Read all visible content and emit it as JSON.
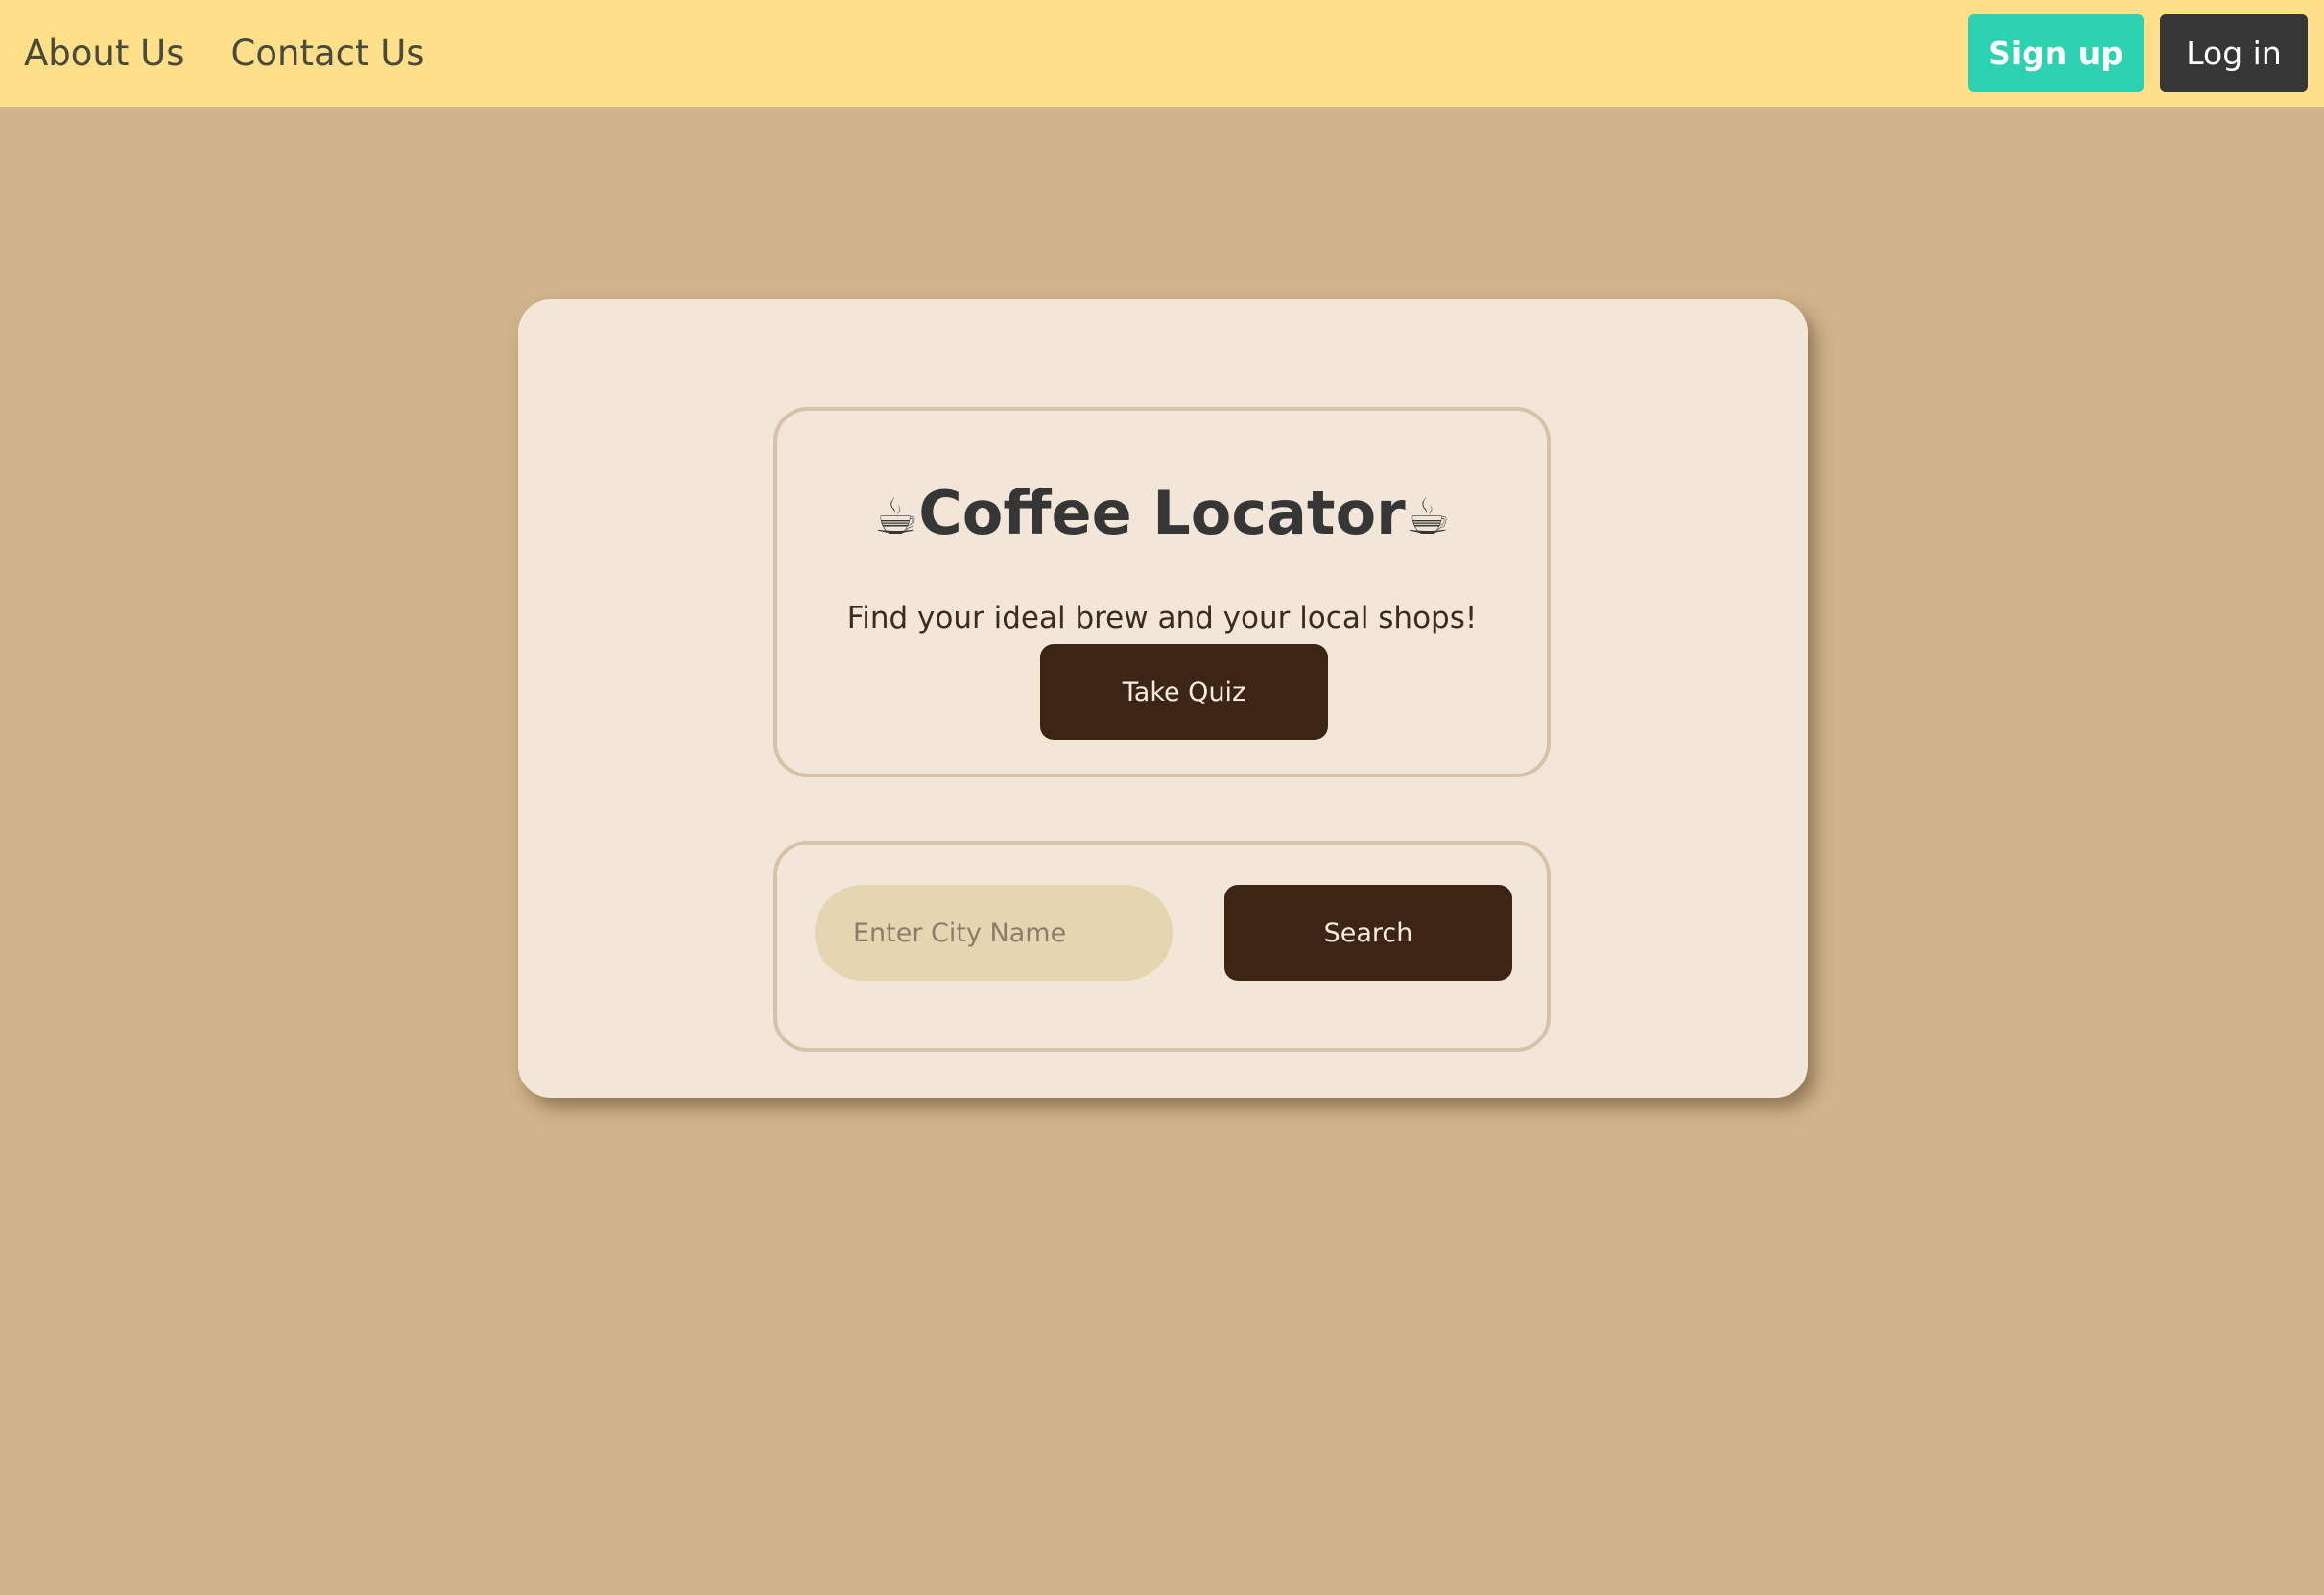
{
  "nav": {
    "links": [
      "About Us",
      "Contact Us"
    ],
    "signup_label": "Sign up",
    "login_label": "Log in"
  },
  "hero": {
    "cup_icon": "☕",
    "title": "Coffee Locator",
    "subtitle": "Find your ideal brew and your local shops!",
    "quiz_label": "Take Quiz"
  },
  "search": {
    "placeholder": "Enter City Name",
    "value": "",
    "button_label": "Search"
  },
  "colors": {
    "background": "#d1b48b",
    "navbar": "#ffdf8a",
    "signup": "#2bd1b0",
    "login": "#363636",
    "card": "#f2e6d9",
    "primary_button": "#3d2516",
    "input": "#e6d5b1"
  }
}
